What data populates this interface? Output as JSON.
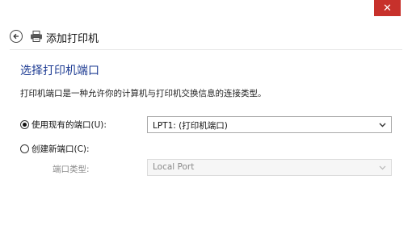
{
  "window": {
    "close_glyph": "✕"
  },
  "header": {
    "title": "添加打印机"
  },
  "page": {
    "heading": "选择打印机端口",
    "description": "打印机端口是一种允许你的计算机与打印机交换信息的连接类型。"
  },
  "options": {
    "existing_port": {
      "label": "使用现有的端口(U):",
      "selected": true,
      "value": "LPT1: (打印机端口)"
    },
    "new_port": {
      "label": "创建新端口(C):",
      "selected": false
    },
    "port_type": {
      "label": "端口类型:",
      "value": "Local Port"
    }
  },
  "colors": {
    "accent": "#1e3c93",
    "close_button": "#c7312b"
  }
}
